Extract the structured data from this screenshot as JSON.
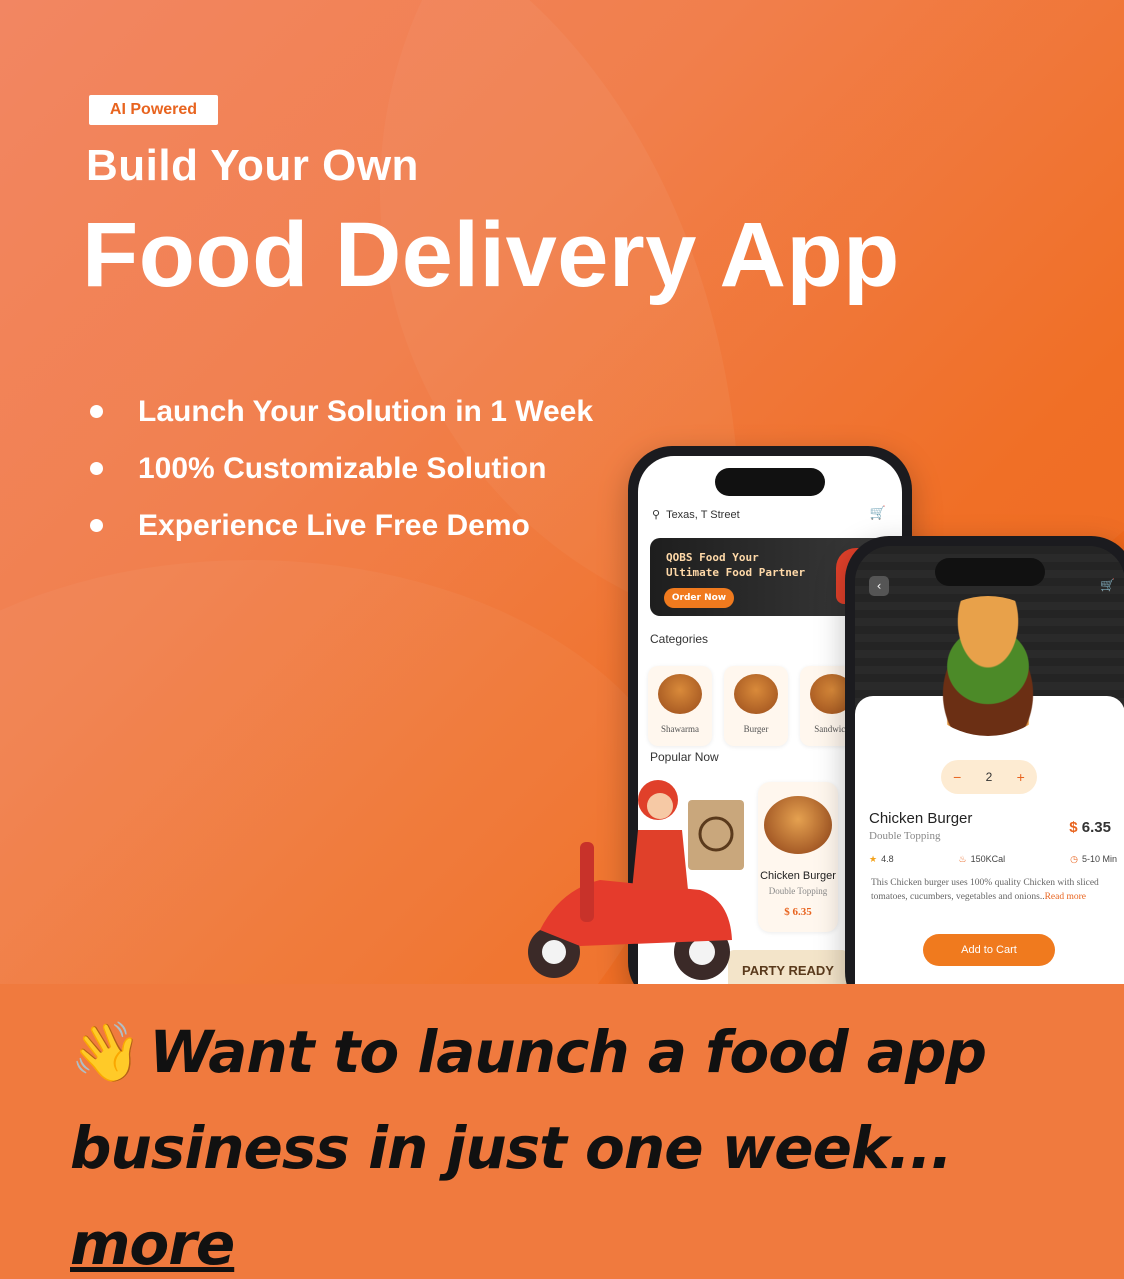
{
  "banner": {
    "badge": "AI Powered",
    "subtitle": "Build Your Own",
    "title": "Food Delivery App",
    "features": [
      "Launch Your Solution in 1 Week",
      "100% Customizable Solution",
      "Experience Live Free Demo"
    ]
  },
  "phone_home": {
    "location": "Texas, T Street",
    "hero_text": "QOBS Food Your\nUltimate Food Partner",
    "hero_button": "Order Now",
    "categories_title": "Categories",
    "categories": [
      "Shawarma",
      "Burger",
      "Sandwich"
    ],
    "popular_title": "Popular Now",
    "popular_item": {
      "name": "Chicken Burger",
      "sub": "Double Topping",
      "price": "$ 6.35"
    },
    "party_label": "PARTY READY"
  },
  "phone_detail": {
    "qty_minus": "−",
    "qty_value": "2",
    "qty_plus": "+",
    "name": "Chicken Burger",
    "sub": "Double Topping",
    "price_currency": "$",
    "price_value": " 6.35",
    "rating": "4.8",
    "calories": "150KCal",
    "time": "5-10 Min",
    "description": "This Chicken burger uses 100% quality Chicken with sliced tomatoes, cucumbers, vegetables and onions..",
    "read_more": "Read more",
    "add_to_cart": "Add to Cart"
  },
  "caption": {
    "emoji": "👋",
    "text": "Want to launch a food app business in just one week... ",
    "more": "more"
  },
  "colors": {
    "accent": "#f07a1e",
    "background": "#f07a3e"
  }
}
